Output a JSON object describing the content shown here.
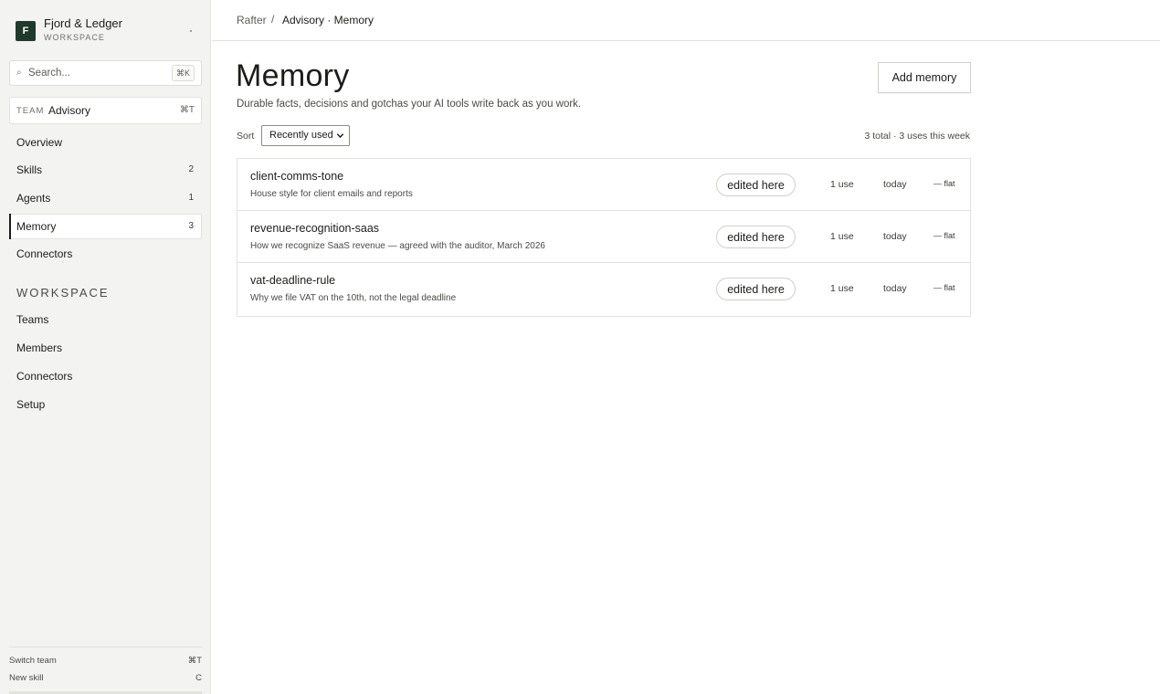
{
  "workspace": {
    "logo_letter": "F",
    "name": "Fjord & Ledger",
    "label": "WORKSPACE"
  },
  "search": {
    "placeholder": "Search...",
    "shortcut": "⌘K",
    "icon": "search-icon"
  },
  "team": {
    "tag": "TEAM",
    "name": "Advisory",
    "shortcut": "⌘T"
  },
  "nav": {
    "overview": {
      "label": "Overview"
    },
    "skills": {
      "label": "Skills",
      "count": "2"
    },
    "agents": {
      "label": "Agents",
      "count": "1"
    },
    "memory": {
      "label": "Memory",
      "count": "3"
    },
    "connectors": {
      "label": "Connectors"
    }
  },
  "workspace_section": {
    "heading": "WORKSPACE",
    "teams": "Teams",
    "members": "Members",
    "connectors": "Connectors",
    "setup": "Setup"
  },
  "footer": {
    "switch_team": "Switch team",
    "switch_team_key": "⌘T",
    "new_skill": "New skill",
    "new_skill_key": "C"
  },
  "breadcrumb": {
    "root": "Rafter",
    "separator": "/",
    "current": "Advisory · Memory"
  },
  "page": {
    "title": "Memory",
    "subtitle": "Durable facts, decisions and gotchas your AI tools write back as you work.",
    "add_button": "Add memory"
  },
  "sort": {
    "label": "Sort",
    "selected": "Recently used"
  },
  "stats": "3 total · 3 uses this week",
  "memories": [
    {
      "title": "client-comms-tone",
      "description": "House style for client emails and reports",
      "status": "edited here",
      "uses": "1 use",
      "last_used": "today",
      "trend": "— flat"
    },
    {
      "title": "revenue-recognition-saas",
      "description": "How we recognize SaaS revenue — agreed with the auditor, March 2026",
      "status": "edited here",
      "uses": "1 use",
      "last_used": "today",
      "trend": "— flat"
    },
    {
      "title": "vat-deadline-rule",
      "description": "Why we file VAT on the 10th, not the legal deadline",
      "status": "edited here",
      "uses": "1 use",
      "last_used": "today",
      "trend": "— flat"
    }
  ],
  "colors": {
    "brand": "#1d3a2b",
    "sidebar_bg": "#f3f3f1",
    "border": "#e2e2de",
    "text": "#1c1c1a"
  }
}
